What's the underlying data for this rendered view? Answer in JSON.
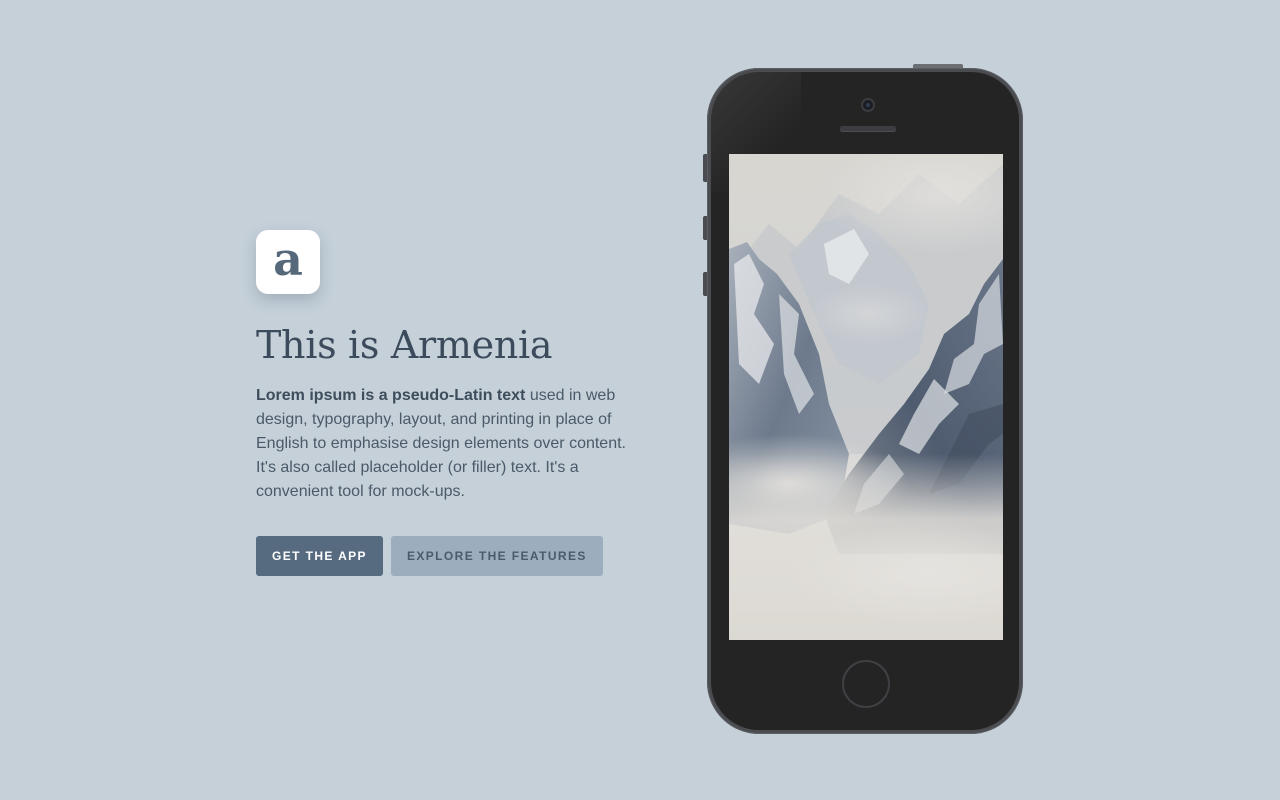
{
  "app_icon": {
    "letter": "a",
    "icon": "app-logo-a"
  },
  "hero": {
    "title": "This is Armenia",
    "description_bold": "Lorem ipsum is a pseudo-Latin text",
    "description_rest": " used in web design, typography, layout, and printing in place of English to emphasise design elements over content. It's also called placeholder (or filler) text. It's a convenient tool for mock-ups."
  },
  "buttons": {
    "primary_label": "GET THE APP",
    "secondary_label": "EXPLORE THE FEATURES"
  },
  "colors": {
    "background": "#c5d0d9",
    "primary_button": "#566b80",
    "secondary_button": "#9cadbd",
    "heading": "#3c4b5b"
  },
  "phone": {
    "screen_image": "misty-mountain-peaks"
  }
}
